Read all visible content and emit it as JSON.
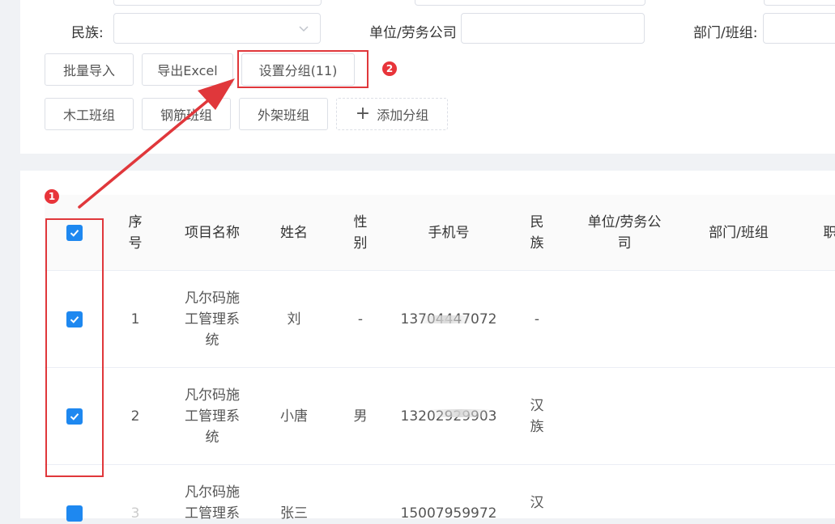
{
  "filters": {
    "ethnicity_label": "民族:",
    "ethnicity_value": "",
    "company_label": "单位/劳务公司",
    "company_value": "",
    "department_label": "部门/班组:",
    "department_value": ""
  },
  "actions": {
    "batch_import": "批量导入",
    "export_excel": "导出Excel",
    "set_group": "设置分组(11)"
  },
  "groups": {
    "items": [
      "木工班组",
      "钢筋班组",
      "外架班组"
    ],
    "add_label": "添加分组"
  },
  "annotations": {
    "badge1": "1",
    "badge2": "2",
    "accent": "#e0373b"
  },
  "table": {
    "headers": {
      "index": "序\n号",
      "project": "项目名称",
      "name": "姓名",
      "gender": "性\n别",
      "phone": "手机号",
      "ethnicity": "民\n族",
      "company": "单位/劳务公\n司",
      "department": "部门/班组",
      "position": "职"
    },
    "rows": [
      {
        "index": "1",
        "project": "凡尔码施\n工管理系\n统",
        "name": "刘",
        "gender": "-",
        "phone": "13704447072",
        "ethnicity": "-",
        "checked": true
      },
      {
        "index": "2",
        "project": "凡尔码施\n工管理系\n统",
        "name": "小唐",
        "gender": "男",
        "phone": "13202929903",
        "ethnicity": "汉\n族",
        "checked": true
      },
      {
        "index": "3",
        "project": "凡尔码施\n工管理系",
        "name": "张三",
        "gender": "",
        "phone": "15007959972",
        "ethnicity": "汉",
        "checked": true
      }
    ]
  }
}
